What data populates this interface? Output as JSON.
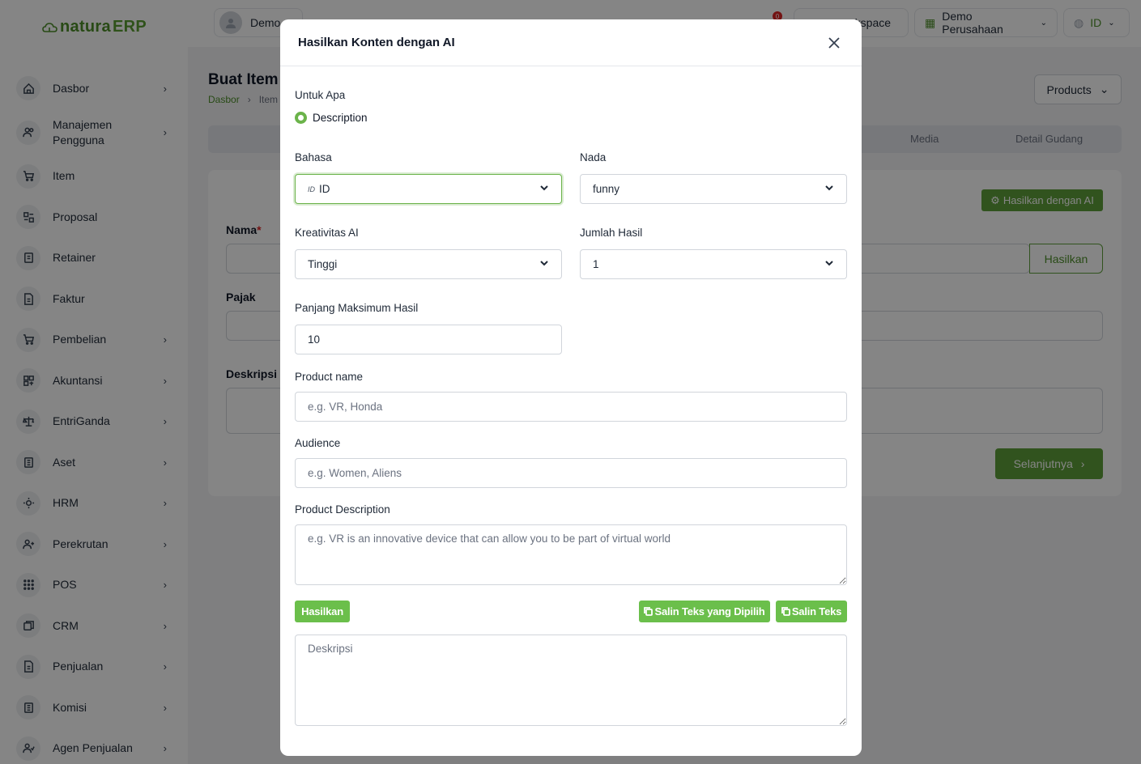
{
  "app": {
    "logo_prefix": "natura",
    "logo_suffix": "ERP"
  },
  "topbar": {
    "user_name": "Demo",
    "notification_count": "0",
    "workspace_label": "rkspace",
    "company_label": "Demo Perusahaan",
    "language_label": "ID"
  },
  "sidebar": {
    "items": [
      {
        "label": "Dasbor",
        "icon": "home-icon",
        "has_children": true
      },
      {
        "label": "Manajemen Pengguna",
        "icon": "users-icon",
        "has_children": true
      },
      {
        "label": "Item",
        "icon": "cart-icon",
        "has_children": false
      },
      {
        "label": "Proposal",
        "icon": "proposal-icon",
        "has_children": false
      },
      {
        "label": "Retainer",
        "icon": "retainer-icon",
        "has_children": false
      },
      {
        "label": "Faktur",
        "icon": "invoice-icon",
        "has_children": false
      },
      {
        "label": "Pembelian",
        "icon": "purchase-icon",
        "has_children": true
      },
      {
        "label": "Akuntansi",
        "icon": "accounting-icon",
        "has_children": true
      },
      {
        "label": "EntriGanda",
        "icon": "scale-icon",
        "has_children": true
      },
      {
        "label": "Aset",
        "icon": "asset-icon",
        "has_children": true
      },
      {
        "label": "HRM",
        "icon": "hrm-icon",
        "has_children": true
      },
      {
        "label": "Perekrutan",
        "icon": "recruit-icon",
        "has_children": true
      },
      {
        "label": "POS",
        "icon": "pos-icon",
        "has_children": true
      },
      {
        "label": "CRM",
        "icon": "crm-icon",
        "has_children": true
      },
      {
        "label": "Penjualan",
        "icon": "sales-icon",
        "has_children": true
      },
      {
        "label": "Komisi",
        "icon": "commission-icon",
        "has_children": true
      },
      {
        "label": "Agen Penjualan",
        "icon": "agent-icon",
        "has_children": true
      }
    ]
  },
  "page": {
    "title": "Buat Item",
    "breadcrumb_home": "Dasbor",
    "breadcrumb_current": "Item",
    "products_button": "Products",
    "tabs": [
      "Media",
      "Detail Gudang"
    ],
    "name_label": "Nama",
    "tax_label": "Pajak",
    "description_label": "Deskripsi",
    "ai_button": "Hasilkan dengan AI",
    "generate_button": "Hasilkan",
    "next_button": "Selanjutnya"
  },
  "modal": {
    "title": "Hasilkan Konten dengan AI",
    "purpose_label": "Untuk Apa",
    "purpose_option": "Description",
    "language_label": "Bahasa",
    "language_flag": "ID",
    "language_value": "ID",
    "tone_label": "Nada",
    "tone_value": "funny",
    "creativity_label": "Kreativitas AI",
    "creativity_value": "Tinggi",
    "results_label": "Jumlah Hasil",
    "results_value": "1",
    "max_length_label": "Panjang Maksimum Hasil",
    "max_length_value": "10",
    "product_name_label": "Product name",
    "product_name_placeholder": "e.g. VR, Honda",
    "audience_label": "Audience",
    "audience_placeholder": "e.g. Women, Aliens",
    "product_desc_label": "Product Description",
    "product_desc_placeholder": "e.g. VR is an innovative device that can allow you to be part of virtual world",
    "generate_button": "Hasilkan",
    "copy_selected_button": "Salin Teks yang Dipilih",
    "copy_button": "Salin Teks",
    "output_placeholder": "Deskripsi"
  },
  "colors": {
    "brand_green": "#5fa03a",
    "button_green": "#6bbf4b",
    "badge_red": "#dc2626"
  }
}
